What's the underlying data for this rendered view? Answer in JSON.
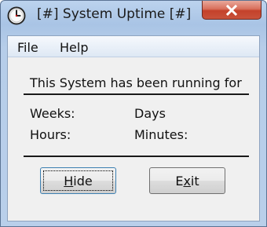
{
  "window": {
    "title": "[#] System Uptime [#]",
    "icon": "clock-icon",
    "close_icon": "close-icon"
  },
  "menu": {
    "items": [
      {
        "label": "File"
      },
      {
        "label": "Help"
      }
    ]
  },
  "content": {
    "heading": "This System has been running for",
    "weeks_label": "Weeks:",
    "days_label": "Days",
    "hours_label": "Hours:",
    "minutes_label": "Minutes:"
  },
  "buttons": {
    "hide": {
      "mnemonic": "H",
      "rest": "ide"
    },
    "exit": {
      "pre": "E",
      "mnemonic": "x",
      "rest": "it"
    }
  },
  "colors": {
    "titlebar": "#b6cde9",
    "close_button": "#c8523b"
  }
}
